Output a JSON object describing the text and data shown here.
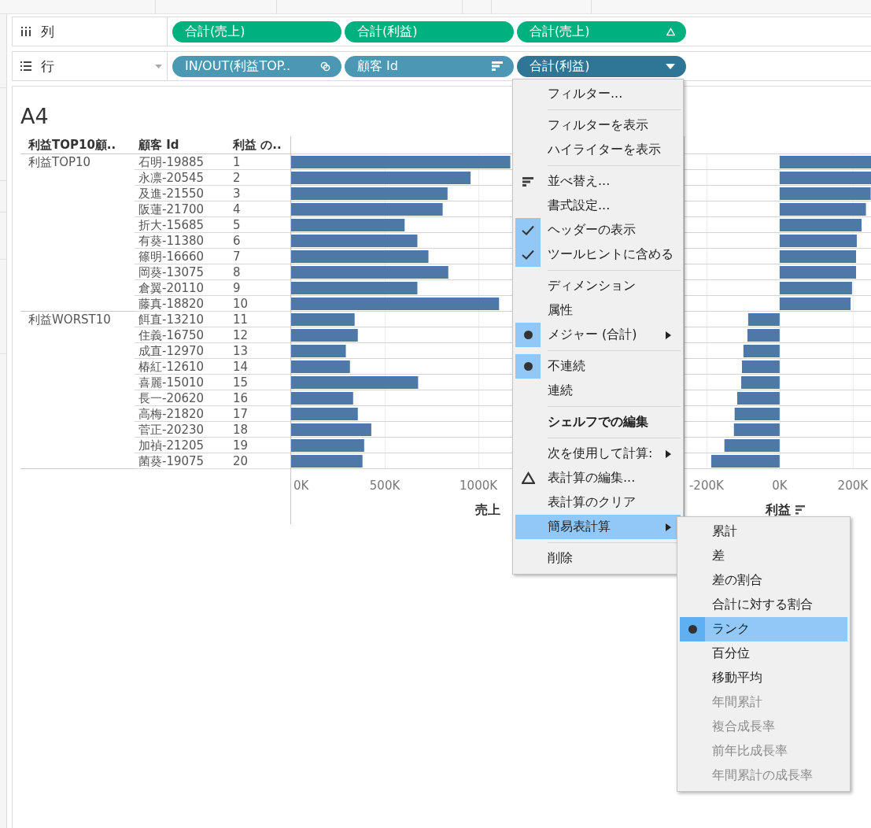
{
  "shelves": [
    {
      "kind": "columns",
      "label": "列",
      "dropdown": false,
      "pills": [
        {
          "label": "合計(売上)",
          "kind": "continuous",
          "selected": false,
          "table_calc": false,
          "combined": false,
          "sorted": false
        },
        {
          "label": "合計(利益)",
          "kind": "continuous",
          "selected": false,
          "table_calc": false,
          "combined": false,
          "sorted": false
        },
        {
          "label": "合計(売上)",
          "kind": "continuous",
          "selected": false,
          "table_calc": true,
          "combined": false,
          "sorted": false
        }
      ]
    },
    {
      "kind": "rows",
      "label": "行",
      "dropdown": true,
      "pills": [
        {
          "label": "IN/OUT(利益TOP..",
          "kind": "discrete",
          "selected": false,
          "table_calc": false,
          "combined": true,
          "sorted": false
        },
        {
          "label": "顧客 Id",
          "kind": "discrete",
          "selected": false,
          "table_calc": false,
          "combined": false,
          "sorted": true
        },
        {
          "label": "合計(利益)",
          "kind": "discrete",
          "selected": true,
          "table_calc": false,
          "combined": false,
          "sorted": false
        }
      ]
    }
  ],
  "sheet": {
    "title": "A4",
    "headers": [
      "利益TOP10顧..",
      "顧客 Id",
      "利益 の.."
    ],
    "groups": [
      {
        "label": "利益TOP10",
        "rows": [
          {
            "customer": "石明-19885",
            "rank": "1"
          },
          {
            "customer": "永凛-20545",
            "rank": "2"
          },
          {
            "customer": "及進-21550",
            "rank": "3"
          },
          {
            "customer": "阪蓮-21700",
            "rank": "4"
          },
          {
            "customer": "折大-15685",
            "rank": "5"
          },
          {
            "customer": "有葵-11380",
            "rank": "6"
          },
          {
            "customer": "篠明-16660",
            "rank": "7"
          },
          {
            "customer": "岡葵-13075",
            "rank": "8"
          },
          {
            "customer": "倉翼-20110",
            "rank": "9"
          },
          {
            "customer": "藤真-18820",
            "rank": "10"
          }
        ]
      },
      {
        "label": "利益WORST10",
        "rows": [
          {
            "customer": "餌直-13210",
            "rank": "11"
          },
          {
            "customer": "住義-16750",
            "rank": "12"
          },
          {
            "customer": "成直-12970",
            "rank": "13"
          },
          {
            "customer": "椿紅-12610",
            "rank": "14"
          },
          {
            "customer": "喜麗-15010",
            "rank": "15"
          },
          {
            "customer": "長一-20620",
            "rank": "16"
          },
          {
            "customer": "高梅-21820",
            "rank": "17"
          },
          {
            "customer": "菅正-20230",
            "rank": "18"
          },
          {
            "customer": "加禎-21205",
            "rank": "19"
          },
          {
            "customer": "菌葵-19075",
            "rank": "20"
          }
        ]
      }
    ],
    "panes": [
      {
        "sorted": false,
        "chart_data": {
          "type": "bar",
          "orientation": "horizontal",
          "grid": true,
          "xlabel": "売上",
          "xlim": [
            0,
            2100000
          ],
          "xticks": [
            {
              "value": 0,
              "label": "0K"
            },
            {
              "value": 500000,
              "label": "500K"
            },
            {
              "value": 1000000,
              "label": "1000K"
            }
          ],
          "values": [
            1170000,
            958000,
            835000,
            809000,
            606000,
            674000,
            733000,
            839000,
            674000,
            1110000,
            339000,
            356000,
            292000,
            314000,
            678000,
            331000,
            356000,
            428000,
            390000,
            381000
          ]
        }
      },
      {
        "sorted": true,
        "chart_data": {
          "type": "bar",
          "orientation": "horizontal",
          "xlabel": "利益",
          "xlim": [
            -260000,
            252000
          ],
          "grid": true,
          "xticks": [
            {
              "value": -200000,
              "label": "-200K"
            },
            {
              "value": 0,
              "label": "0K"
            },
            {
              "value": 200000,
              "label": "200K"
            }
          ],
          "values": [
            251000,
            250000,
            249000,
            236000,
            224000,
            211000,
            209000,
            209000,
            198000,
            194000,
            -86000,
            -88000,
            -99000,
            -103000,
            -105000,
            -116000,
            -123000,
            -125000,
            -151000,
            -187000
          ]
        }
      }
    ]
  },
  "menu": {
    "sections": [
      {
        "items": [
          {
            "label": "フィルター...",
            "kind": "command",
            "selected": false,
            "submenu": false,
            "bold": false
          }
        ]
      },
      {
        "items": [
          {
            "label": "フィルターを表示",
            "kind": "check",
            "checked": false,
            "selected": false,
            "submenu": false,
            "bold": false
          },
          {
            "label": "ハイライターを表示",
            "kind": "check",
            "checked": false,
            "selected": false,
            "submenu": false,
            "bold": false
          }
        ]
      },
      {
        "items": [
          {
            "label": "並べ替え...",
            "kind": "sort",
            "selected": false,
            "submenu": false,
            "bold": false
          },
          {
            "label": "書式設定...",
            "kind": "command",
            "selected": false,
            "submenu": false,
            "bold": false
          },
          {
            "label": "ヘッダーの表示",
            "kind": "check",
            "checked": true,
            "selected": false,
            "submenu": false,
            "bold": false
          },
          {
            "label": "ツールヒントに含める",
            "kind": "check",
            "checked": true,
            "selected": false,
            "submenu": false,
            "bold": false
          }
        ]
      },
      {
        "items": [
          {
            "label": "ディメンション",
            "kind": "radio",
            "checked": false,
            "selected": false,
            "submenu": false,
            "bold": false
          },
          {
            "label": "属性",
            "kind": "radio",
            "checked": false,
            "selected": false,
            "submenu": false,
            "bold": false
          },
          {
            "label": "メジャー (合計)",
            "kind": "radio",
            "checked": true,
            "selected": false,
            "submenu": true,
            "bold": false
          }
        ]
      },
      {
        "items": [
          {
            "label": "不連続",
            "kind": "radio",
            "checked": true,
            "selected": false,
            "submenu": false,
            "bold": false
          },
          {
            "label": "連続",
            "kind": "radio",
            "checked": false,
            "selected": false,
            "submenu": false,
            "bold": false
          }
        ]
      },
      {
        "items": [
          {
            "label": "シェルフでの編集",
            "kind": "command",
            "selected": false,
            "submenu": false,
            "bold": true
          }
        ]
      },
      {
        "items": [
          {
            "label": "次を使用して計算:",
            "kind": "command",
            "selected": false,
            "submenu": true,
            "bold": false
          },
          {
            "label": "表計算の編集...",
            "kind": "delta",
            "selected": false,
            "submenu": false,
            "bold": false
          },
          {
            "label": "表計算のクリア",
            "kind": "command",
            "selected": false,
            "submenu": false,
            "bold": false
          },
          {
            "label": "簡易表計算",
            "kind": "command",
            "selected": true,
            "submenu": true,
            "bold": false
          }
        ]
      },
      {
        "items": [
          {
            "label": "削除",
            "kind": "command",
            "selected": false,
            "submenu": false,
            "bold": false
          }
        ]
      }
    ]
  },
  "submenu": {
    "items": [
      {
        "label": "累計",
        "kind": "radio",
        "checked": false,
        "selected": false,
        "disabled": false
      },
      {
        "label": "差",
        "kind": "radio",
        "checked": false,
        "selected": false,
        "disabled": false
      },
      {
        "label": "差の割合",
        "kind": "radio",
        "checked": false,
        "selected": false,
        "disabled": false
      },
      {
        "label": "合計に対する割合",
        "kind": "radio",
        "checked": false,
        "selected": false,
        "disabled": false
      },
      {
        "label": "ランク",
        "kind": "radio",
        "checked": true,
        "selected": true,
        "disabled": false
      },
      {
        "label": "百分位",
        "kind": "radio",
        "checked": false,
        "selected": false,
        "disabled": false
      },
      {
        "label": "移動平均",
        "kind": "radio",
        "checked": false,
        "selected": false,
        "disabled": false
      },
      {
        "label": "年間累計",
        "kind": "radio",
        "checked": false,
        "selected": false,
        "disabled": true
      },
      {
        "label": "複合成長率",
        "kind": "radio",
        "checked": false,
        "selected": false,
        "disabled": true
      },
      {
        "label": "前年比成長率",
        "kind": "radio",
        "checked": false,
        "selected": false,
        "disabled": true
      },
      {
        "label": "年間累計の成長率",
        "kind": "radio",
        "checked": false,
        "selected": false,
        "disabled": true
      }
    ]
  }
}
